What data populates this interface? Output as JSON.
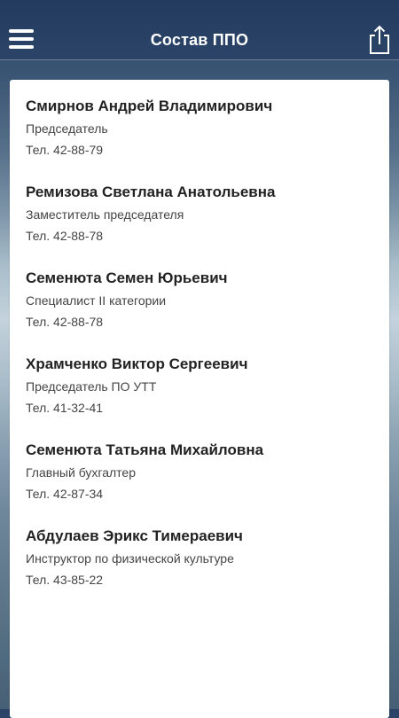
{
  "header": {
    "title": "Состав ППО",
    "menu_icon": "hamburger-menu-icon",
    "share_icon": "share-icon"
  },
  "contacts": [
    {
      "name": "Смирнов Андрей Владимирович",
      "role": "Председатель",
      "phone": "Тел. 42-88-79"
    },
    {
      "name": "Ремизова Светлана Анатольевна",
      "role": "Заместитель председателя",
      "phone": "Тел. 42-88-78"
    },
    {
      "name": "Семенюта Семен Юрьевич",
      "role": "Специалист II категории",
      "phone": "Тел. 42-88-78"
    },
    {
      "name": "Храмченко Виктор Сергеевич",
      "role": "Председатель ПО УТТ",
      "phone": "Тел. 41-32-41"
    },
    {
      "name": "Семенюта Татьяна Михайловна",
      "role": "Главный бухгалтер",
      "phone": "Тел. 42-87-34"
    },
    {
      "name": "Абдулаев Эрикс Тимераевич",
      "role": "Инструктор по физической культуре",
      "phone": "Тел. 43-85-22"
    }
  ],
  "colors": {
    "header_bg": "#223b5f",
    "card_bg": "#ffffff",
    "title_text": "#ffffff",
    "name_text": "#222222",
    "detail_text": "#444444"
  }
}
